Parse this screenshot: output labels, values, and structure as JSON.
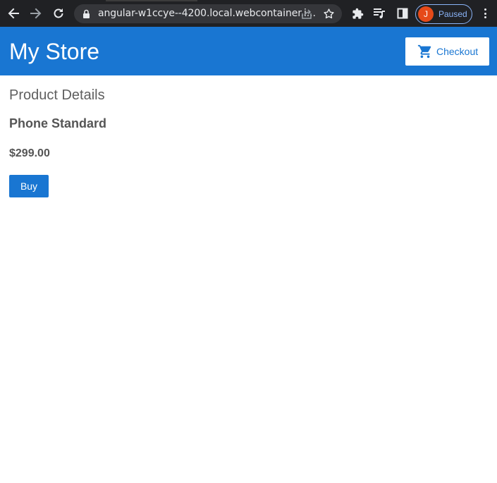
{
  "browser": {
    "url": "angular-w1ccye--4200.local.webcontainer.i...",
    "profile": {
      "initial": "J",
      "status": "Paused"
    },
    "icons": [
      "back-icon",
      "forward-icon",
      "reload-icon",
      "lock-icon",
      "share-icon",
      "star-icon",
      "extensions-icon",
      "media-queue-icon",
      "side-panel-icon",
      "menu-icon"
    ]
  },
  "header": {
    "title": "My Store",
    "checkout_label": "Checkout",
    "cart_icon": "cart-icon"
  },
  "main": {
    "section_title": "Product Details",
    "product": {
      "name": "Phone Standard",
      "price": "$299.00"
    },
    "buy_label": "Buy"
  },
  "colors": {
    "primary": "#1976d2",
    "chrome_bg": "#202124",
    "omnibox_bg": "#35363a",
    "text_muted": "#555555",
    "avatar_bg": "#e64a19",
    "paused_accent": "#8ab4f8"
  }
}
